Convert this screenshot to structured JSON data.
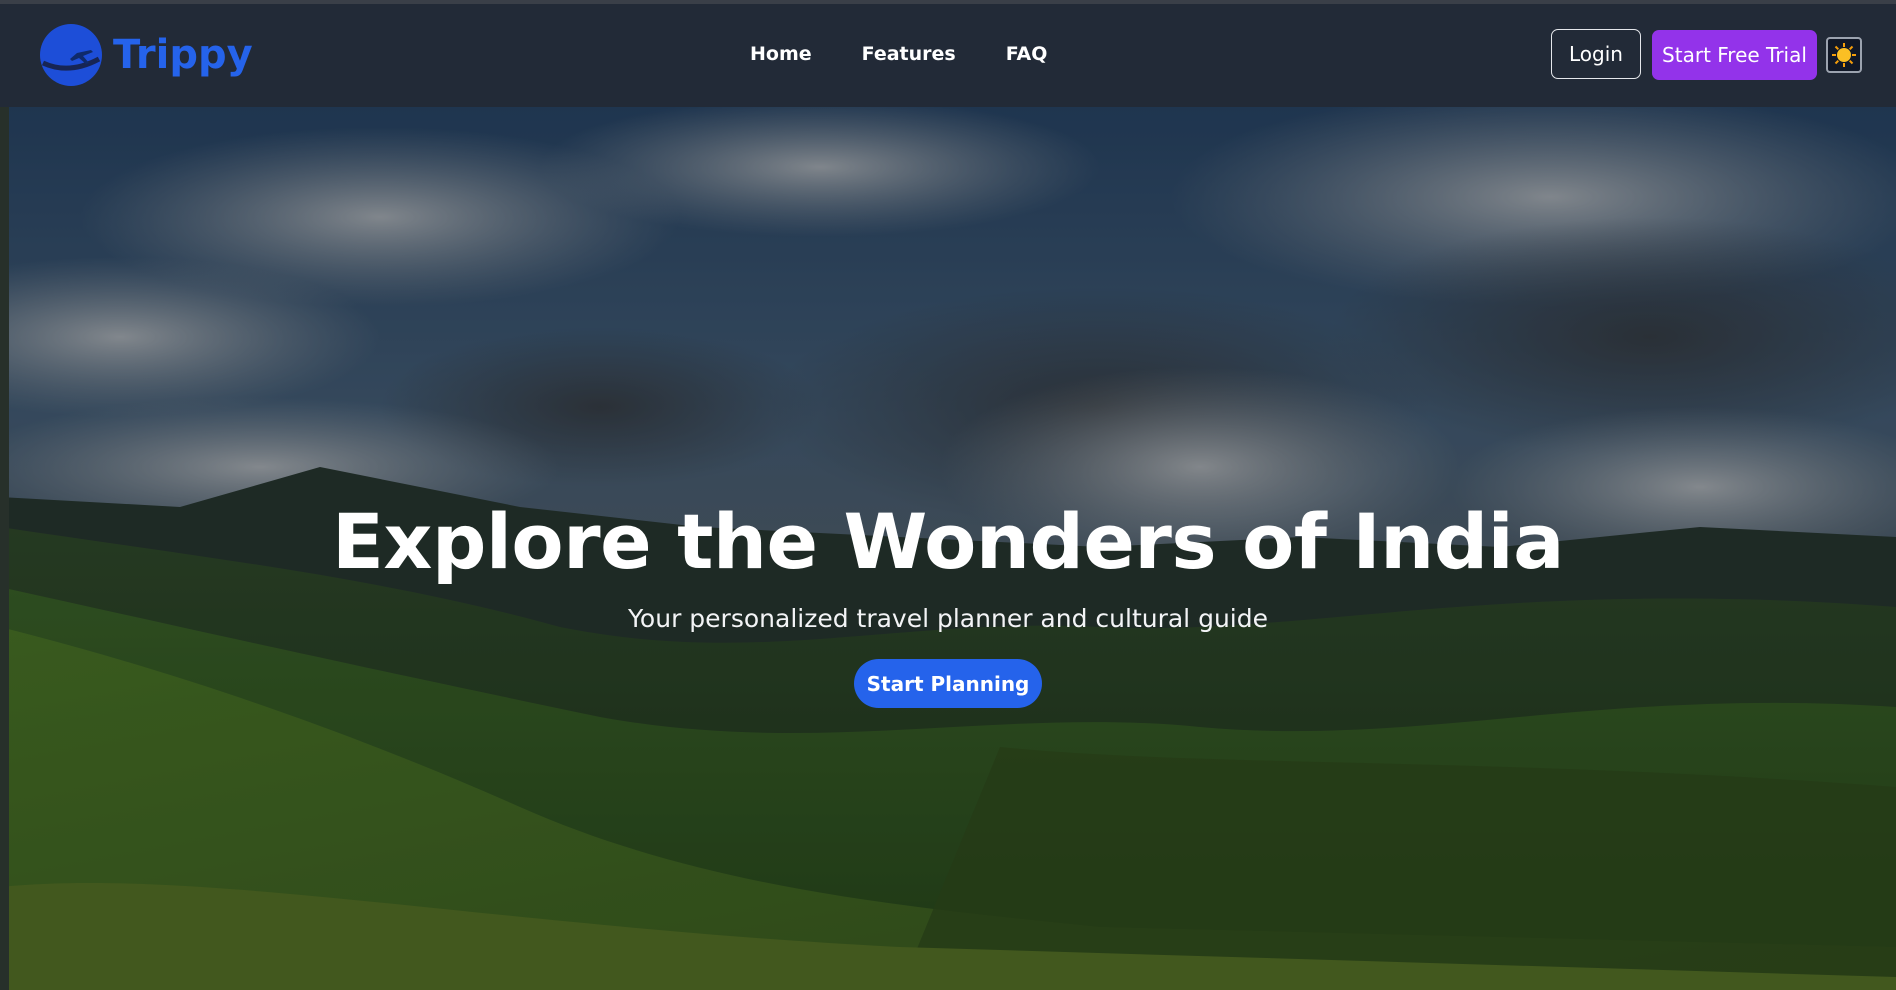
{
  "brand": {
    "name": "Trippy",
    "logo_icon": "globe-airplane-icon",
    "color": "#2563eb"
  },
  "nav": {
    "links": [
      {
        "label": "Home"
      },
      {
        "label": "Features"
      },
      {
        "label": "FAQ"
      }
    ],
    "login_label": "Login",
    "trial_label": "Start Free Trial",
    "trial_color": "#9333ea",
    "theme_icon": "sun-icon"
  },
  "hero": {
    "title": "Explore the Wonders of India",
    "subtitle": "Your personalized travel planner and cultural guide",
    "cta_label": "Start Planning",
    "cta_color": "#2563eb",
    "background": "mountain-landscape-image"
  }
}
